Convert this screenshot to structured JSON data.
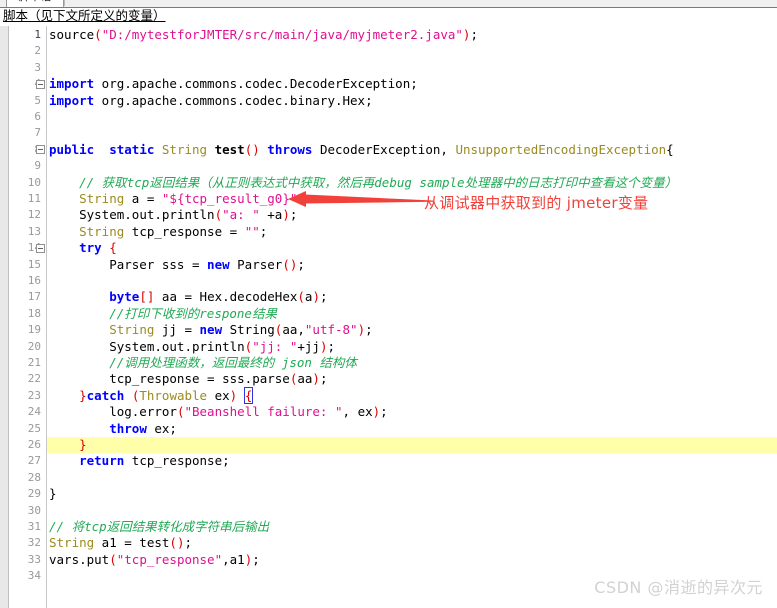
{
  "window": {
    "tab_label": "脚本语",
    "section_label": "脚本（见下文所定义的变量）"
  },
  "editor": {
    "highlight_line": 26,
    "fold_lines": [
      4,
      8,
      14
    ],
    "total_lines": 34,
    "colors": {
      "keyword": "#0000ff",
      "type": "#9b8b1e",
      "string": "#e01090",
      "punctuation": "#dd0000",
      "comment": "#22aa55",
      "plain": "#000000",
      "current_line_highlight": "#ffffaa",
      "line_number": "#999999",
      "background": "#ffffff"
    },
    "lines": [
      {
        "n": 1,
        "tokens": [
          {
            "t": "source",
            "c": "pln"
          },
          {
            "t": "(",
            "c": "punc"
          },
          {
            "t": "\"D:/mytestforJMTER/src/main/java/myjmeter2.java\"",
            "c": "str"
          },
          {
            "t": ")",
            "c": "punc"
          },
          {
            "t": ";",
            "c": "pln"
          }
        ]
      },
      {
        "n": 2,
        "tokens": []
      },
      {
        "n": 3,
        "tokens": []
      },
      {
        "n": 4,
        "tokens": [
          {
            "t": "import",
            "c": "kw"
          },
          {
            "t": " org.apache.commons.codec.DecoderException;",
            "c": "pln"
          }
        ]
      },
      {
        "n": 5,
        "tokens": [
          {
            "t": "import",
            "c": "kw"
          },
          {
            "t": " org.apache.commons.codec.binary.Hex;",
            "c": "pln"
          }
        ]
      },
      {
        "n": 6,
        "tokens": []
      },
      {
        "n": 7,
        "tokens": []
      },
      {
        "n": 8,
        "tokens": [
          {
            "t": "public",
            "c": "kw"
          },
          {
            "t": "  ",
            "c": "pln"
          },
          {
            "t": "static",
            "c": "kw"
          },
          {
            "t": " ",
            "c": "pln"
          },
          {
            "t": "String",
            "c": "typ"
          },
          {
            "t": " ",
            "c": "pln"
          },
          {
            "t": "test",
            "c": "fn"
          },
          {
            "t": "()",
            "c": "punc"
          },
          {
            "t": " ",
            "c": "pln"
          },
          {
            "t": "throws",
            "c": "kw"
          },
          {
            "t": " DecoderException, ",
            "c": "pln"
          },
          {
            "t": "UnsupportedEncodingException",
            "c": "typ"
          },
          {
            "t": "{",
            "c": "pln"
          }
        ]
      },
      {
        "n": 9,
        "tokens": []
      },
      {
        "n": 10,
        "tokens": [
          {
            "t": "    ",
            "c": "pln"
          },
          {
            "t": "// 获取tcp返回结果（从正则表达式中获取，然后再debug sample处理器中的日志打印中查看这个变量）",
            "c": "cmt"
          }
        ]
      },
      {
        "n": 11,
        "tokens": [
          {
            "t": "    ",
            "c": "pln"
          },
          {
            "t": "String",
            "c": "typ"
          },
          {
            "t": " a = ",
            "c": "pln"
          },
          {
            "t": "\"${tcp_result_g0}\"",
            "c": "str"
          },
          {
            "t": ";",
            "c": "pln"
          }
        ]
      },
      {
        "n": 12,
        "tokens": [
          {
            "t": "    ",
            "c": "pln"
          },
          {
            "t": "System.out.println",
            "c": "pln"
          },
          {
            "t": "(",
            "c": "punc"
          },
          {
            "t": "\"a: \"",
            "c": "str"
          },
          {
            "t": " +a",
            "c": "pln"
          },
          {
            "t": ")",
            "c": "punc"
          },
          {
            "t": ";",
            "c": "pln"
          }
        ]
      },
      {
        "n": 13,
        "tokens": [
          {
            "t": "    ",
            "c": "pln"
          },
          {
            "t": "String",
            "c": "typ"
          },
          {
            "t": " tcp_response = ",
            "c": "pln"
          },
          {
            "t": "\"\"",
            "c": "str"
          },
          {
            "t": ";",
            "c": "pln"
          }
        ]
      },
      {
        "n": 14,
        "tokens": [
          {
            "t": "    ",
            "c": "pln"
          },
          {
            "t": "try",
            "c": "kw"
          },
          {
            "t": " ",
            "c": "pln"
          },
          {
            "t": "{",
            "c": "punc"
          }
        ]
      },
      {
        "n": 15,
        "tokens": [
          {
            "t": "        Parser sss = ",
            "c": "pln"
          },
          {
            "t": "new",
            "c": "kw"
          },
          {
            "t": " Parser",
            "c": "pln"
          },
          {
            "t": "()",
            "c": "punc"
          },
          {
            "t": ";",
            "c": "pln"
          }
        ]
      },
      {
        "n": 16,
        "tokens": []
      },
      {
        "n": 17,
        "tokens": [
          {
            "t": "        ",
            "c": "pln"
          },
          {
            "t": "byte",
            "c": "kw"
          },
          {
            "t": "[]",
            "c": "punc"
          },
          {
            "t": " aa = Hex.decodeHex",
            "c": "pln"
          },
          {
            "t": "(",
            "c": "punc"
          },
          {
            "t": "a",
            "c": "pln"
          },
          {
            "t": ")",
            "c": "punc"
          },
          {
            "t": ";",
            "c": "pln"
          }
        ]
      },
      {
        "n": 18,
        "tokens": [
          {
            "t": "        ",
            "c": "pln"
          },
          {
            "t": "//打印下收到的respone结果",
            "c": "cmt"
          }
        ]
      },
      {
        "n": 19,
        "tokens": [
          {
            "t": "        ",
            "c": "pln"
          },
          {
            "t": "String",
            "c": "typ"
          },
          {
            "t": " jj = ",
            "c": "pln"
          },
          {
            "t": "new",
            "c": "kw"
          },
          {
            "t": " String",
            "c": "pln"
          },
          {
            "t": "(",
            "c": "punc"
          },
          {
            "t": "aa,",
            "c": "pln"
          },
          {
            "t": "\"utf-8\"",
            "c": "str"
          },
          {
            "t": ")",
            "c": "punc"
          },
          {
            "t": ";",
            "c": "pln"
          }
        ]
      },
      {
        "n": 20,
        "tokens": [
          {
            "t": "        System.out.println",
            "c": "pln"
          },
          {
            "t": "(",
            "c": "punc"
          },
          {
            "t": "\"jj: \"",
            "c": "str"
          },
          {
            "t": "+jj",
            "c": "pln"
          },
          {
            "t": ")",
            "c": "punc"
          },
          {
            "t": ";",
            "c": "pln"
          }
        ]
      },
      {
        "n": 21,
        "tokens": [
          {
            "t": "        ",
            "c": "pln"
          },
          {
            "t": "//调用处理函数，返回最终的 json 结构体",
            "c": "cmt"
          }
        ]
      },
      {
        "n": 22,
        "tokens": [
          {
            "t": "        tcp_response = sss.parse",
            "c": "pln"
          },
          {
            "t": "(",
            "c": "punc"
          },
          {
            "t": "aa",
            "c": "pln"
          },
          {
            "t": ")",
            "c": "punc"
          },
          {
            "t": ";",
            "c": "pln"
          }
        ]
      },
      {
        "n": 23,
        "tokens": [
          {
            "t": "    ",
            "c": "pln"
          },
          {
            "t": "}",
            "c": "punc"
          },
          {
            "t": "catch",
            "c": "kw"
          },
          {
            "t": " ",
            "c": "pln"
          },
          {
            "t": "(",
            "c": "punc"
          },
          {
            "t": "Throwable",
            "c": "typ"
          },
          {
            "t": " ex",
            "c": "pln"
          },
          {
            "t": ")",
            "c": "punc"
          },
          {
            "t": " ",
            "c": "pln"
          },
          {
            "t": "{",
            "c": "brace-match"
          }
        ]
      },
      {
        "n": 24,
        "tokens": [
          {
            "t": "        log.error",
            "c": "pln"
          },
          {
            "t": "(",
            "c": "punc"
          },
          {
            "t": "\"Beanshell failure: \"",
            "c": "str"
          },
          {
            "t": ", ex",
            "c": "pln"
          },
          {
            "t": ")",
            "c": "punc"
          },
          {
            "t": ";",
            "c": "pln"
          }
        ]
      },
      {
        "n": 25,
        "tokens": [
          {
            "t": "        ",
            "c": "pln"
          },
          {
            "t": "throw",
            "c": "kw"
          },
          {
            "t": " ex;",
            "c": "pln"
          }
        ]
      },
      {
        "n": 26,
        "tokens": [
          {
            "t": "    ",
            "c": "pln"
          },
          {
            "t": "}",
            "c": "punc"
          }
        ]
      },
      {
        "n": 27,
        "tokens": [
          {
            "t": "    ",
            "c": "pln"
          },
          {
            "t": "return",
            "c": "kw"
          },
          {
            "t": " tcp_response;",
            "c": "pln"
          }
        ]
      },
      {
        "n": 28,
        "tokens": []
      },
      {
        "n": 29,
        "tokens": [
          {
            "t": "}",
            "c": "pln"
          }
        ]
      },
      {
        "n": 30,
        "tokens": []
      },
      {
        "n": 31,
        "tokens": [
          {
            "t": "// 将tcp返回结果转化成字符串后输出",
            "c": "cmt"
          }
        ]
      },
      {
        "n": 32,
        "tokens": [
          {
            "t": "String",
            "c": "typ"
          },
          {
            "t": " a1 = test",
            "c": "pln"
          },
          {
            "t": "()",
            "c": "punc"
          },
          {
            "t": ";",
            "c": "pln"
          }
        ]
      },
      {
        "n": 33,
        "tokens": [
          {
            "t": "vars.put",
            "c": "pln"
          },
          {
            "t": "(",
            "c": "punc"
          },
          {
            "t": "\"tcp_response\"",
            "c": "str"
          },
          {
            "t": ",a1",
            "c": "pln"
          },
          {
            "t": ")",
            "c": "punc"
          },
          {
            "t": ";",
            "c": "pln"
          }
        ]
      },
      {
        "n": 34,
        "tokens": []
      }
    ]
  },
  "annotation": {
    "text": "从调试器中获取到的 jmeter变量",
    "color": "#f2403a",
    "arrow_direction": "left",
    "points_at_line": 11
  },
  "watermark": {
    "text": "CSDN @消逝的异次元"
  }
}
